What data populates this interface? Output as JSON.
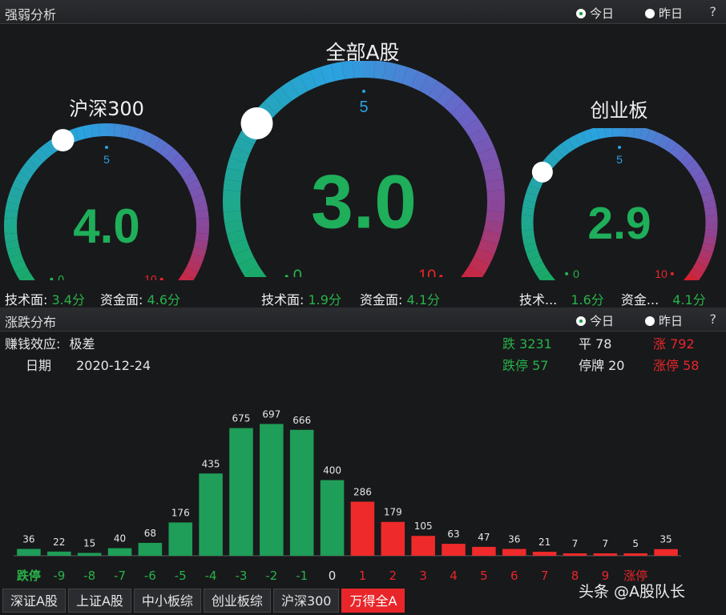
{
  "top_panel": {
    "title": "强弱分析",
    "radio_today": "今日",
    "radio_yesterday": "昨日",
    "help": "?"
  },
  "gauges": [
    {
      "name": "沪深300",
      "value": "4.0",
      "level": 4.0,
      "mid": "5",
      "min": "0",
      "max": "10"
    },
    {
      "name": "全部A股",
      "value": "3.0",
      "level": 3.0,
      "mid": "5",
      "min": "0",
      "max": "10"
    },
    {
      "name": "创业板",
      "value": "2.9",
      "level": 2.9,
      "mid": "5",
      "min": "0",
      "max": "10"
    }
  ],
  "gauge_stats": [
    {
      "tech_label": "技术面:",
      "tech_value": "3.4分",
      "fund_label": "资金面:",
      "fund_value": "4.6分"
    },
    {
      "tech_label": "技术面:",
      "tech_value": "1.9分",
      "fund_label": "资金面:",
      "fund_value": "4.1分"
    },
    {
      "tech_label": "技术...",
      "tech_value": "1.6分",
      "fund_label": "资金...",
      "fund_value": "4.1分"
    }
  ],
  "dist_panel": {
    "title": "涨跌分布",
    "radio_today": "今日",
    "radio_yesterday": "昨日",
    "help": "?",
    "effect_label": "赚钱效应:",
    "effect_value": "极差",
    "date_label": "日期",
    "date_value": "2020-12-24",
    "down_label": "跌",
    "down_value": "3231",
    "flat_label": "平",
    "flat_value": "78",
    "up_label": "涨",
    "up_value": "792",
    "limit_down_label": "跌停",
    "limit_down_value": "57",
    "suspended_label": "停牌",
    "suspended_value": "20",
    "limit_up_label": "涨停",
    "limit_up_value": "58"
  },
  "chart_data": {
    "type": "bar",
    "categories": [
      "跌停",
      "-9",
      "-8",
      "-7",
      "-6",
      "-5",
      "-4",
      "-3",
      "-2",
      "-1",
      "0",
      "1",
      "2",
      "3",
      "4",
      "5",
      "6",
      "7",
      "8",
      "9",
      "涨停"
    ],
    "values": [
      36,
      22,
      15,
      40,
      68,
      176,
      435,
      675,
      697,
      666,
      400,
      286,
      179,
      105,
      63,
      47,
      36,
      21,
      7,
      7,
      5,
      35
    ],
    "value_labels": [
      "36",
      "22",
      "15",
      "40",
      "68",
      "176",
      "435",
      "675",
      "697",
      "666",
      "400",
      "286",
      "179",
      "105",
      "63",
      "47",
      "36",
      "21",
      "7",
      "7",
      "5",
      "35"
    ],
    "bar_colors": [
      "#1e9e58",
      "#1e9e58",
      "#1e9e58",
      "#1e9e58",
      "#1e9e58",
      "#1e9e58",
      "#1e9e58",
      "#1e9e58",
      "#1e9e58",
      "#1e9e58",
      "#1e9e58",
      "#ee2a2a",
      "#ee2a2a",
      "#ee2a2a",
      "#ee2a2a",
      "#ee2a2a",
      "#ee2a2a",
      "#ee2a2a",
      "#ee2a2a",
      "#ee2a2a",
      "#ee2a2a",
      "#ee2a2a"
    ],
    "tick_colors": [
      "#27b34a",
      "#27b34a",
      "#27b34a",
      "#27b34a",
      "#27b34a",
      "#27b34a",
      "#27b34a",
      "#27b34a",
      "#27b34a",
      "#27b34a",
      "#e6e6e6",
      "#e8262a",
      "#e8262a",
      "#e8262a",
      "#e8262a",
      "#e8262a",
      "#e8262a",
      "#e8262a",
      "#e8262a",
      "#e8262a",
      "#e8262a"
    ],
    "ylim": [
      0,
      720
    ],
    "grid": false
  },
  "tabs": [
    {
      "label": "深证A股",
      "active": false
    },
    {
      "label": "上证A股",
      "active": false
    },
    {
      "label": "中小板综",
      "active": false
    },
    {
      "label": "创业板综",
      "active": false
    },
    {
      "label": "沪深300",
      "active": false
    },
    {
      "label": "万得全A",
      "active": true
    }
  ],
  "watermark": "头条 @A股队长",
  "colors": {
    "green": "#27b34a",
    "red": "#e8262a",
    "accent_blue": "#2aa3e0",
    "background": "#18191b"
  }
}
